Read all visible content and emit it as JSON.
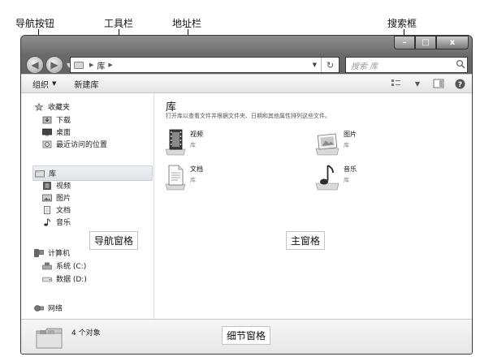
{
  "callouts": {
    "nav_buttons": "导航按钮",
    "toolbar": "工具栏",
    "address_bar": "地址栏",
    "search_box": "搜索框",
    "nav_pane": "导航窗格",
    "main_pane": "主窗格",
    "details_pane": "细节窗格"
  },
  "window": {
    "controls": {
      "minimize": "–",
      "maximize": "□",
      "close": "x"
    },
    "address": {
      "crumb": "库"
    },
    "search": {
      "placeholder": "搜索 库"
    },
    "toolbar": {
      "organize": "组织",
      "new_library": "新建库"
    }
  },
  "sidebar": {
    "favorites": {
      "label": "收藏夹",
      "items": [
        "下载",
        "桌面",
        "最近访问的位置"
      ]
    },
    "libraries": {
      "label": "库",
      "items": [
        "视频",
        "图片",
        "文档",
        "音乐"
      ]
    },
    "computer": {
      "label": "计算机",
      "items": [
        "系统 (C:)",
        "数据 (D:)"
      ]
    },
    "network": {
      "label": "网络"
    }
  },
  "main": {
    "title": "库",
    "description": "打开库以查看文件并根据文件夹、日期和其他属性排列这些文件。",
    "libraries": [
      {
        "name": "视频",
        "type": "库",
        "icon": "video-library-icon"
      },
      {
        "name": "图片",
        "type": "库",
        "icon": "picture-library-icon"
      },
      {
        "name": "文档",
        "type": "库",
        "icon": "document-library-icon"
      },
      {
        "name": "音乐",
        "type": "库",
        "icon": "music-library-icon"
      }
    ]
  },
  "details": {
    "count": "4 个对象"
  },
  "colors": {
    "frame": "#6e6e6e",
    "selection": "#dfe3e8",
    "details_bg": "#e6e6e6"
  }
}
